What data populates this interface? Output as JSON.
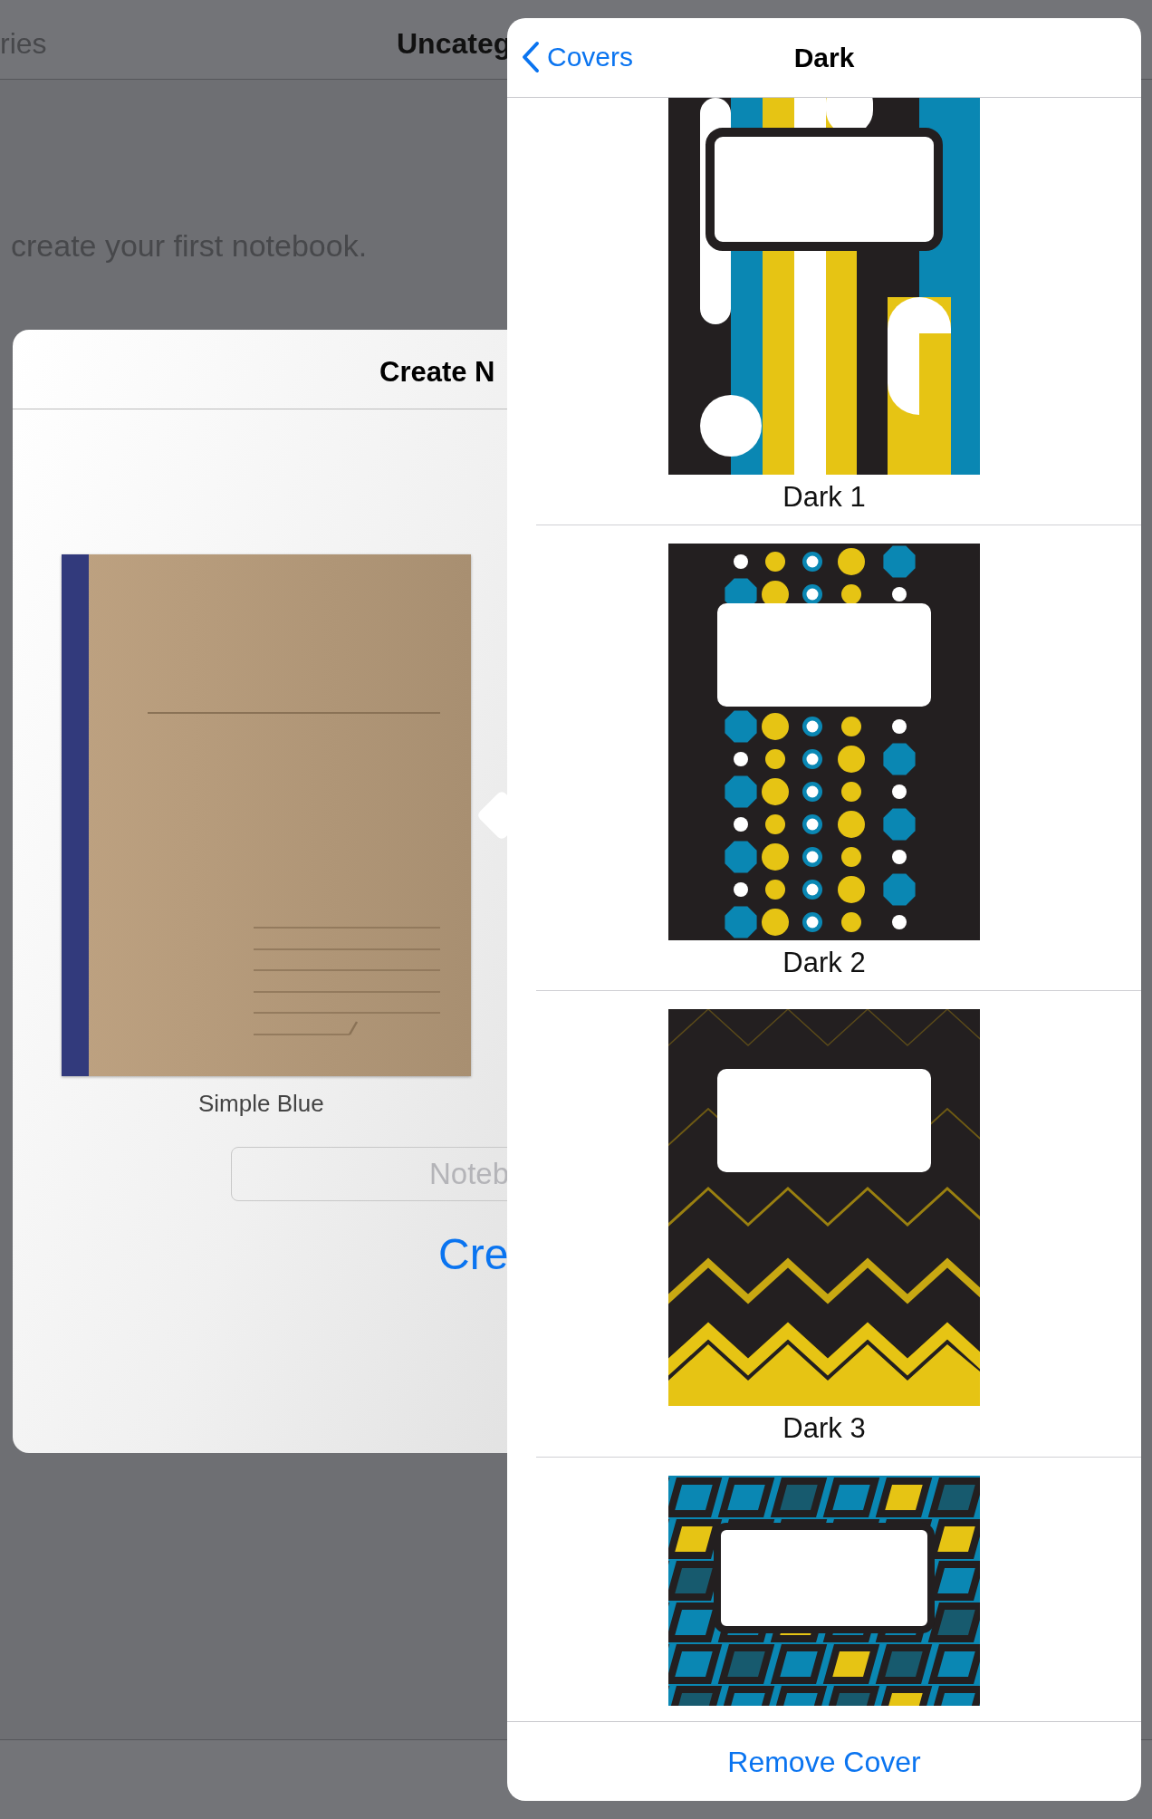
{
  "background": {
    "nav_left": "ries",
    "nav_title": "Uncateg",
    "empty_message": "create your first notebook."
  },
  "create_sheet": {
    "title": "Create N",
    "cover_name": "Simple Blue",
    "name_field": {
      "placeholder": "Noteb"
    },
    "create_button": "Cre"
  },
  "covers_popover": {
    "back_button": "Covers",
    "title": "Dark",
    "covers": [
      {
        "label": "Dark 1",
        "kind": "stripes"
      },
      {
        "label": "Dark 2",
        "kind": "dots"
      },
      {
        "label": "Dark 3",
        "kind": "zigzag"
      },
      {
        "kind": "tiles"
      }
    ],
    "remove_button": "Remove Cover"
  }
}
